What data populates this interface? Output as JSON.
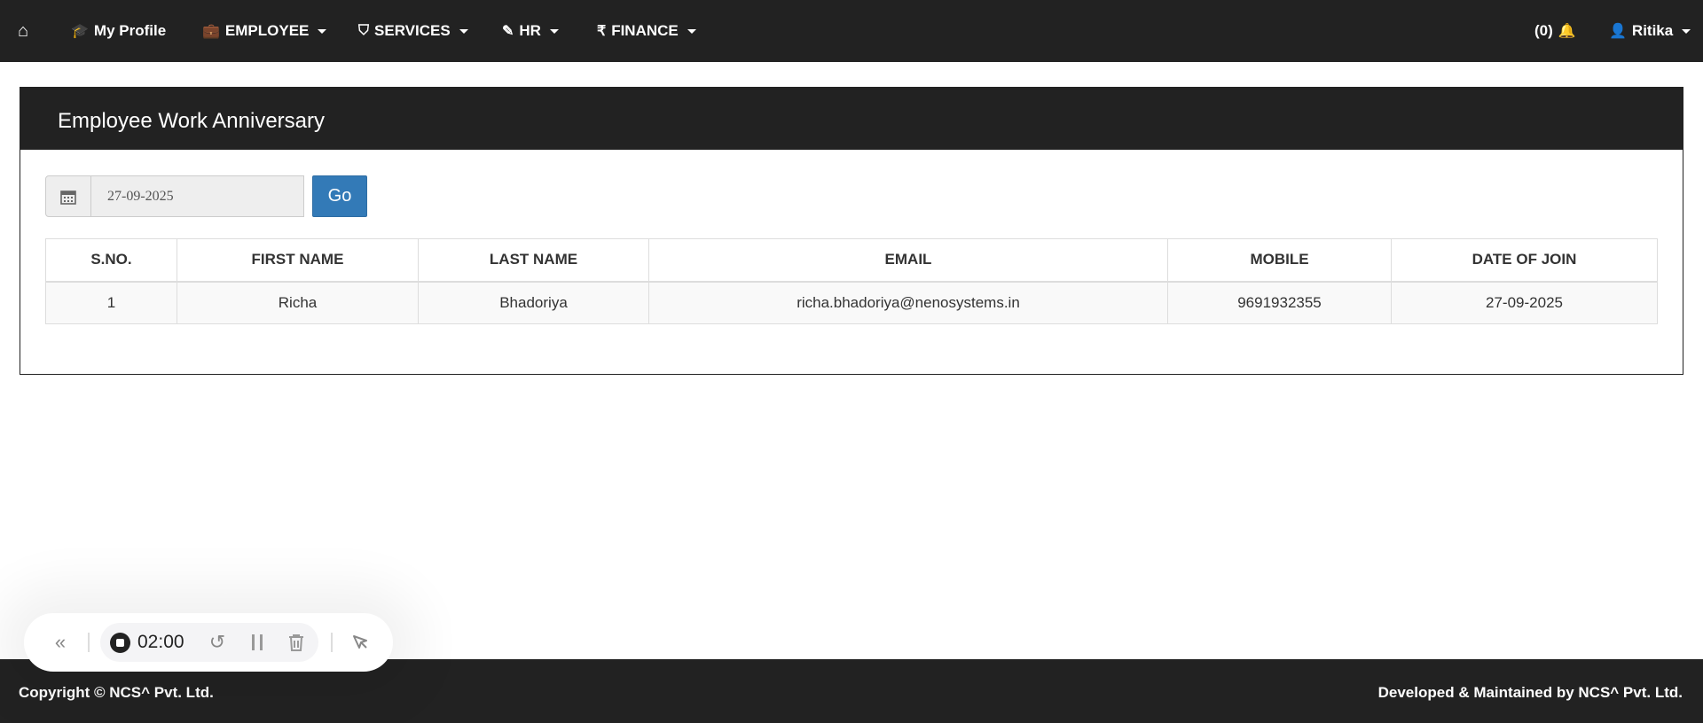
{
  "nav": {
    "home": "home",
    "my_profile": "My Profile",
    "employee": "EMPLOYEE",
    "services": "SERVICES",
    "hr": "HR",
    "finance": "FINANCE",
    "notifications": "(0)",
    "user": "Ritika"
  },
  "panel": {
    "title": "Employee Work Anniversary",
    "date_value": "27-09-2025",
    "go_label": "Go"
  },
  "table": {
    "headers": [
      "S.NO.",
      "FIRST NAME",
      "LAST NAME",
      "EMAIL",
      "MOBILE",
      "DATE OF JOIN"
    ],
    "rows": [
      [
        "1",
        "Richa",
        "Bhadoriya",
        "richa.bhadoriya@nenosystems.in",
        "9691932355",
        "27-09-2025"
      ]
    ]
  },
  "recorder": {
    "time": "02:00"
  },
  "footer": {
    "left": "Copyright © NCS^ Pvt. Ltd.",
    "right": "Developed & Maintained by NCS^ Pvt. Ltd."
  }
}
